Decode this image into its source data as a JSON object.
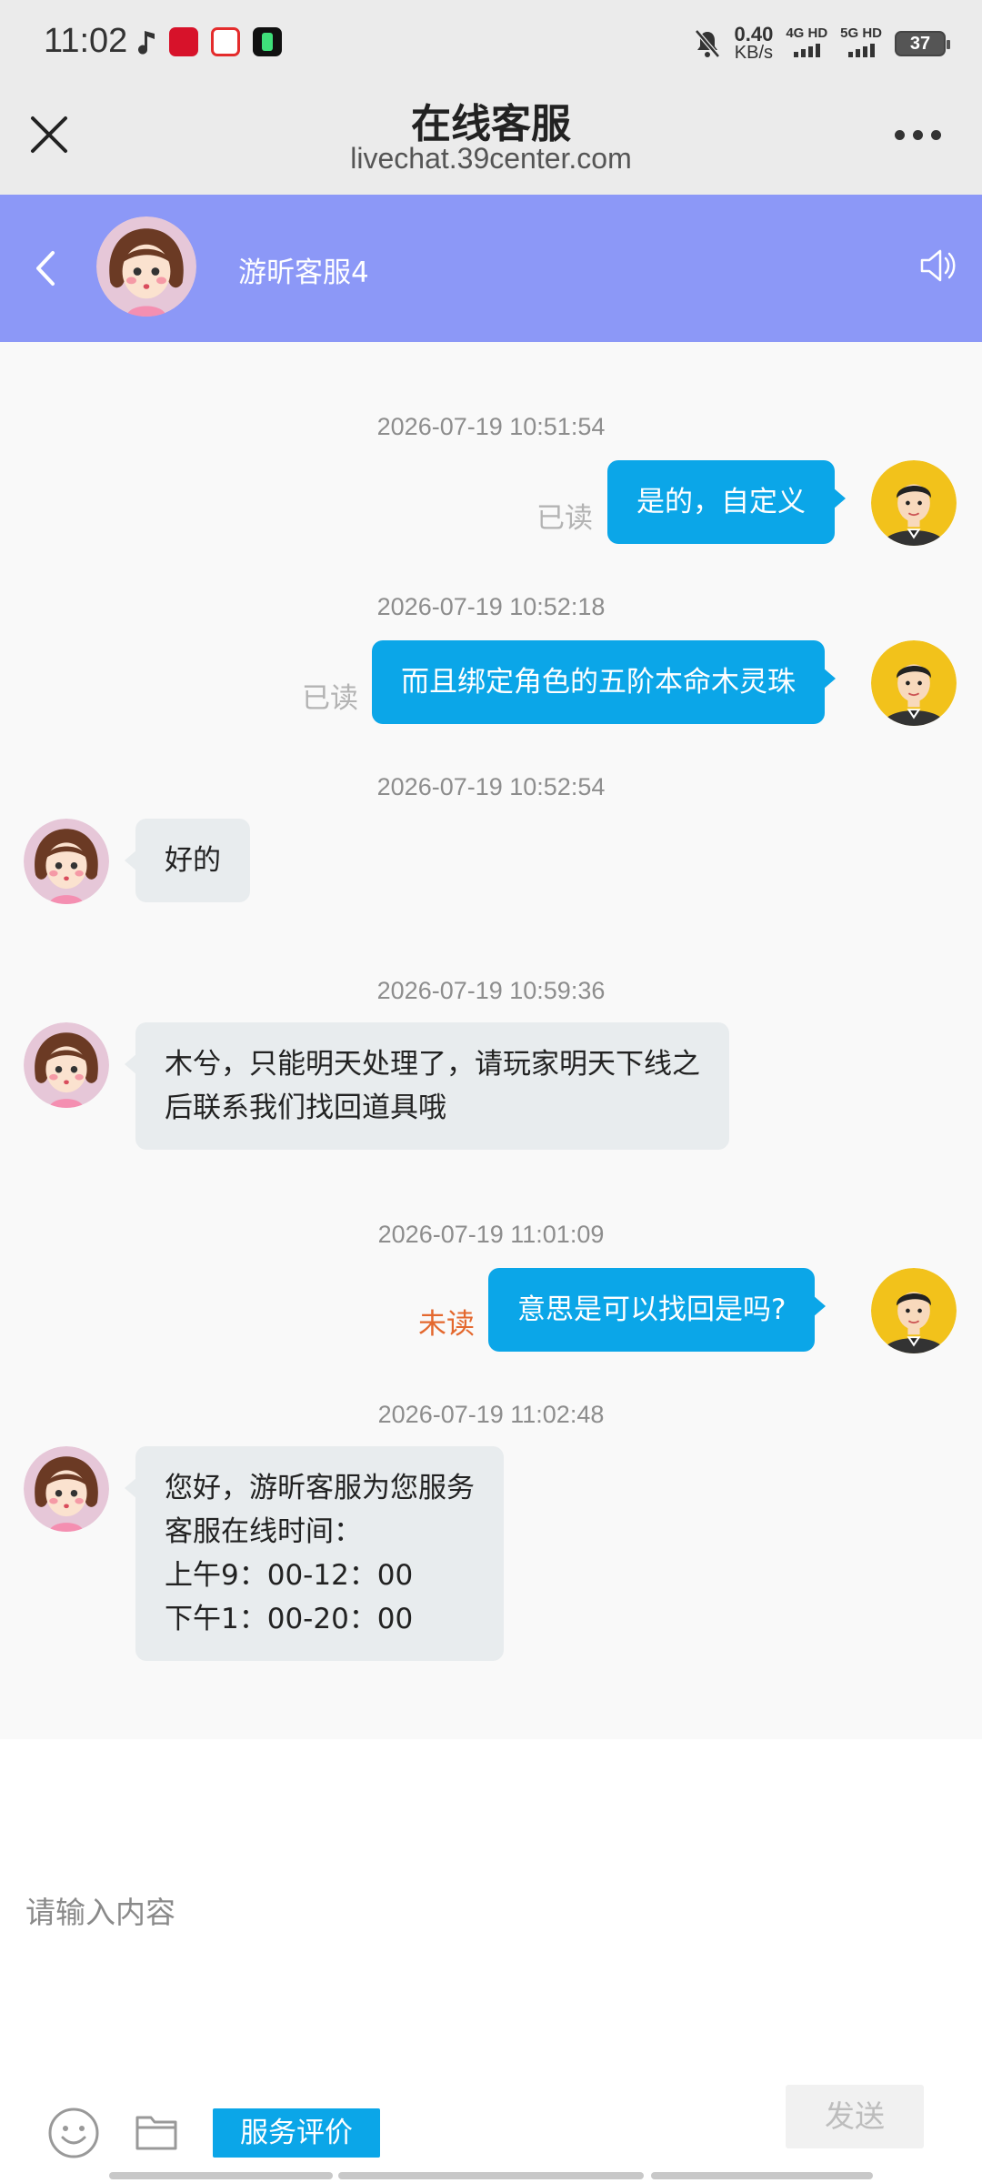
{
  "status_bar": {
    "time": "11:02",
    "net_speed": "0.40",
    "net_unit": "KB/s",
    "sim1": "4G HD",
    "sim2": "5G HD",
    "battery": "37"
  },
  "browser": {
    "title": "在线客服",
    "url": "livechat.39center.com"
  },
  "chat_header": {
    "agent_name": "游昕客服4"
  },
  "messages": [
    {
      "time": "2026-07-19 10:51:54",
      "side": "out",
      "text": "是的，自定义",
      "status": "已读"
    },
    {
      "time": "2026-07-19 10:52:18",
      "side": "out",
      "text": "而且绑定角色的五阶本命木灵珠",
      "status": "已读"
    },
    {
      "time": "2026-07-19 10:52:54",
      "side": "in",
      "lines": [
        "好的"
      ]
    },
    {
      "time": "2026-07-19 10:59:36",
      "side": "in",
      "lines": [
        "木兮，只能明天处理了，请玩家明天下线之",
        "后联系我们找回道具哦"
      ]
    },
    {
      "time": "2026-07-19 11:01:09",
      "side": "out",
      "text": "意思是可以找回是吗?",
      "status": "未读"
    },
    {
      "time": "2026-07-19 11:02:48",
      "side": "in",
      "lines": [
        "您好，游昕客服为您服务",
        "客服在线时间：",
        "上午9：00-12：00",
        "下午1：00-20：00"
      ]
    }
  ],
  "input": {
    "placeholder": "请输入内容",
    "rate_label": "服务评价",
    "send_label": "发送"
  },
  "colors": {
    "header_bg": "#8c98f7",
    "bubble_out": "#0ba6e8",
    "bubble_in": "#e8ecee",
    "unread": "#e4682e"
  }
}
